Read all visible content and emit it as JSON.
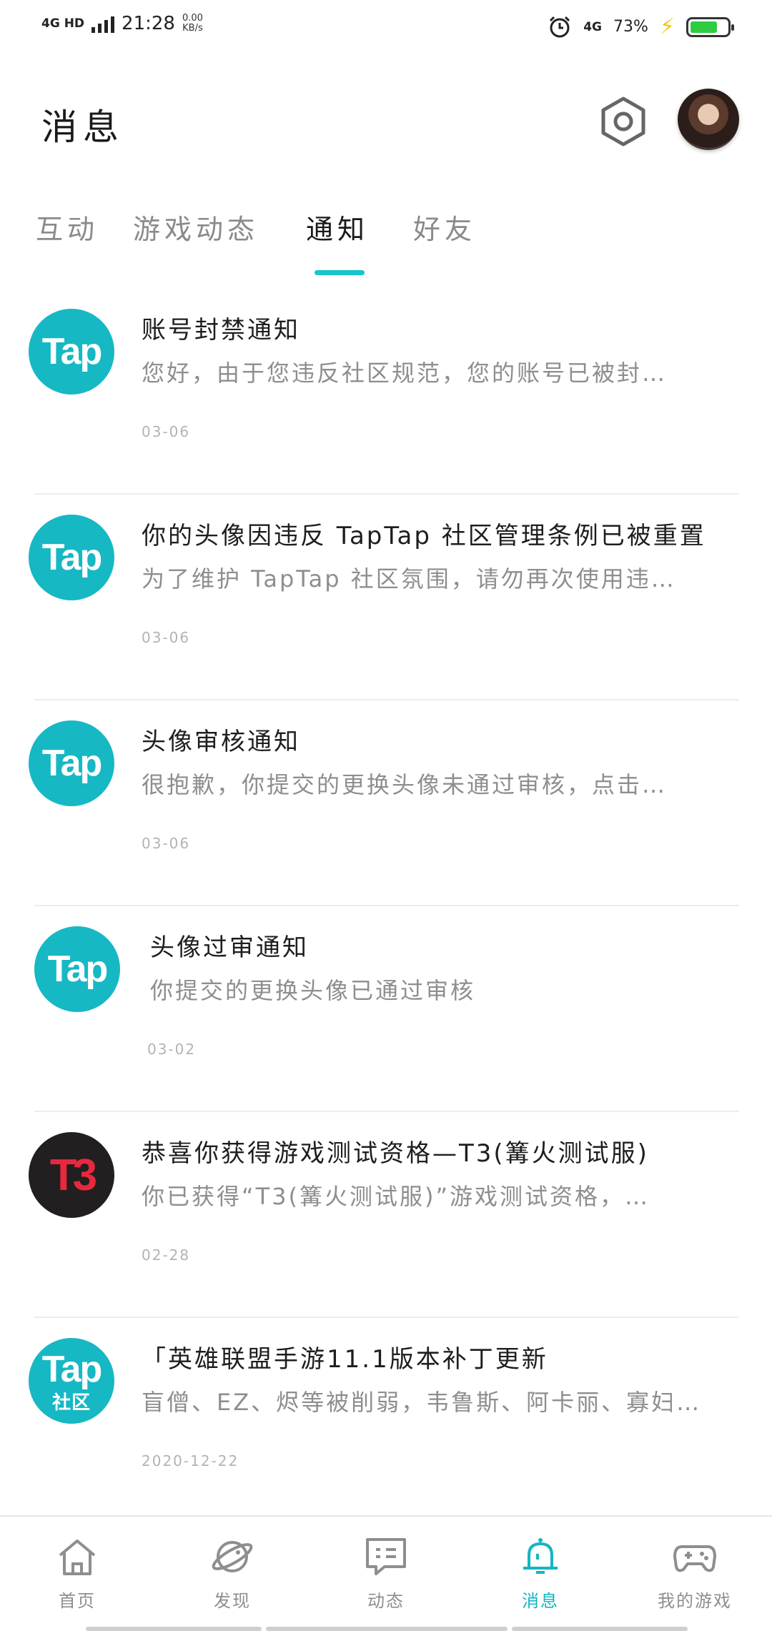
{
  "status_bar": {
    "network": "4G HD",
    "time": "21:28",
    "speed_value": "0.00",
    "speed_unit": "KB/s",
    "mobile": "4G",
    "battery": "73%",
    "battery_level": 0.73,
    "battery_color": "#2ecc40"
  },
  "header": {
    "title": "消息"
  },
  "tabs": [
    {
      "label": "互动"
    },
    {
      "label": "游戏动态"
    },
    {
      "label": "通知",
      "active": true
    },
    {
      "label": "好友"
    }
  ],
  "accent_color": "#15c5ce",
  "notifications": [
    {
      "logo": "Tap",
      "title": "账号封禁通知",
      "preview": "您好，由于您违反社区规范，您的账号已被封…",
      "date": "03-06"
    },
    {
      "logo": "Tap",
      "title": "你的头像因违反 TapTap 社区管理条例已被重置",
      "preview": "为了维护 TapTap 社区氛围，请勿再次使用违…",
      "date": "03-06"
    },
    {
      "logo": "Tap",
      "title": "头像审核通知",
      "preview": "很抱歉，你提交的更换头像未通过审核，点击…",
      "date": "03-06"
    },
    {
      "logo": "Tap",
      "title": "头像过审通知",
      "preview": "你提交的更换头像已通过审核",
      "date": "03-02"
    },
    {
      "logo": "T3",
      "title": "恭喜你获得游戏测试资格—T3(篝火测试服)",
      "preview": "你已获得“T3(篝火测试服)”游戏测试资格，…",
      "date": "02-28"
    },
    {
      "logo": "Tap",
      "logo_sub": "社区",
      "title": "「英雄联盟手游11.1版本补丁更新",
      "preview": "盲僧、EZ、烬等被削弱，韦鲁斯、阿卡丽、寡妇…",
      "date": "2020-12-22"
    }
  ],
  "bottom_nav": [
    {
      "label": "首页",
      "icon": "home-icon"
    },
    {
      "label": "发现",
      "icon": "discover-icon"
    },
    {
      "label": "动态",
      "icon": "feed-icon"
    },
    {
      "label": "消息",
      "icon": "bell-icon",
      "active": true
    },
    {
      "label": "我的游戏",
      "icon": "gamepad-icon"
    }
  ]
}
